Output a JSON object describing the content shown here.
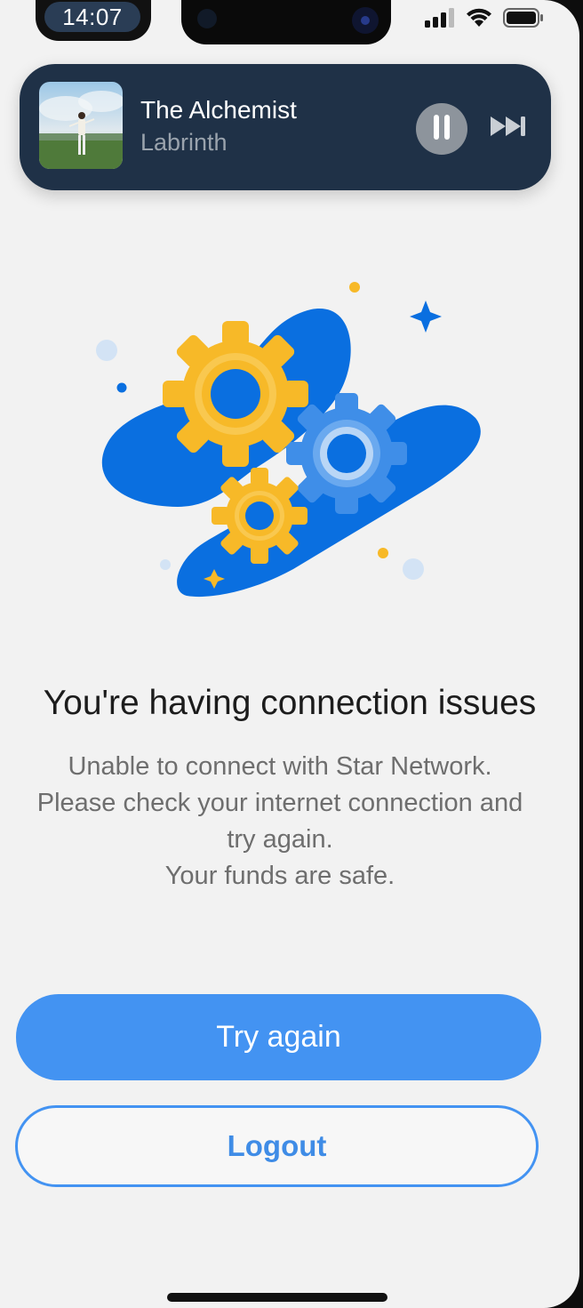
{
  "status_bar": {
    "time": "14:07",
    "icons": [
      "cellular-signal-icon",
      "wifi-icon",
      "battery-icon"
    ]
  },
  "now_playing": {
    "title": "The Alchemist",
    "artist": "Labrinth",
    "controls": [
      "pause-icon",
      "next-track-icon"
    ]
  },
  "illustration": {
    "icons": [
      "gear-icon",
      "gear-icon",
      "gear-icon",
      "sparkle-icon"
    ],
    "colors": {
      "cloud": "#0a6fe0",
      "gear_yellow": "#f7b928",
      "gear_blue": "#3f8ee8"
    }
  },
  "error": {
    "heading": "You're having connection issues",
    "message_lines": [
      "Unable to connect with Star Network.",
      "Please check your internet connection and",
      "try again.",
      "Your funds are safe."
    ]
  },
  "actions": {
    "primary_label": "Try again",
    "secondary_label": "Logout"
  },
  "colors": {
    "accent": "#4393f2",
    "background": "#f2f2f2",
    "player_bg": "#1f3147"
  }
}
